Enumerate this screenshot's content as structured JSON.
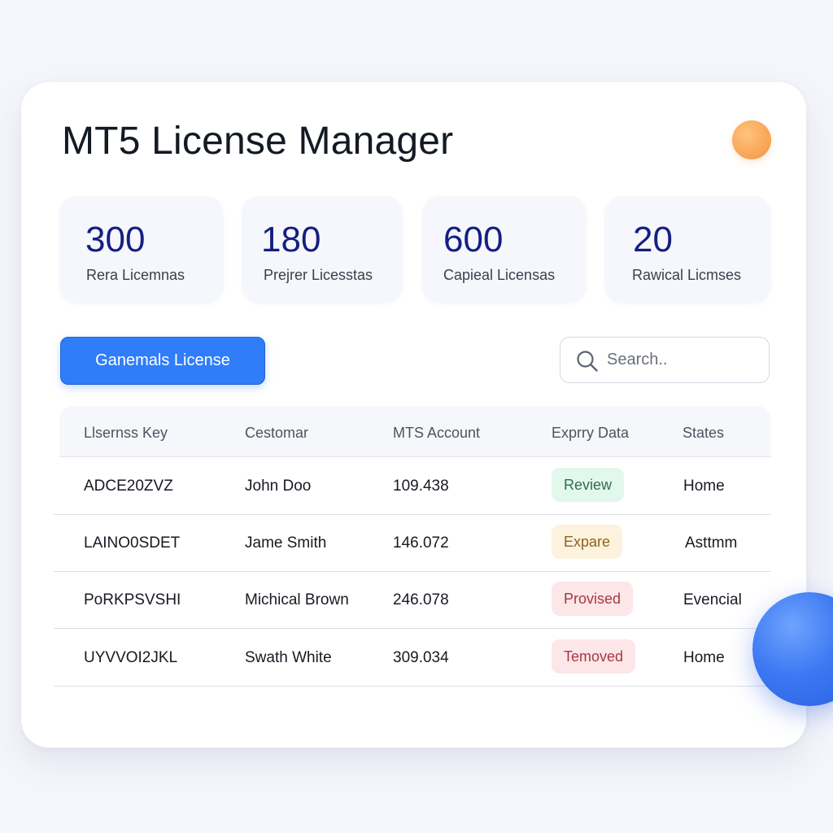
{
  "header": {
    "title": "MT5 License Manager"
  },
  "stats": [
    {
      "value": "300",
      "label": "Rera Licemnas"
    },
    {
      "value": "180",
      "label": "Prejrer Licesstas"
    },
    {
      "value": "600",
      "label": "Capieal Licensas"
    },
    {
      "value": "20",
      "label": "Rawical Licmses"
    }
  ],
  "actions": {
    "primary_label": "Ganemals License"
  },
  "search": {
    "placeholder": "Search.."
  },
  "table": {
    "columns": [
      "Llsernss Key",
      "Cestomar",
      "MTS Account",
      "Exprry Data",
      "States"
    ],
    "rows": [
      {
        "key": "ADCE20ZVZ",
        "customer": "John Doo",
        "account": "109.438",
        "expiry": "Review",
        "status": "Home"
      },
      {
        "key": "LAINO0SDET",
        "customer": "Jame Smith",
        "account": "146.072",
        "expiry": "Expare",
        "status": "Asttmm"
      },
      {
        "key": "PoRKPSVSHI",
        "customer": "Michical Brown",
        "account": "246.078",
        "expiry": "Provised",
        "status": "Evencial"
      },
      {
        "key": "UYVVOI2JKL",
        "customer": "Swath White",
        "account": "309.034",
        "expiry": "Temoved",
        "status": "Home"
      }
    ]
  },
  "colors": {
    "accent": "#2f7df8",
    "badge_review_bg": "#e3f8ec",
    "badge_review_text": "#2f6f4c",
    "badge_expare_bg": "#fdf2dd",
    "badge_expare_text": "#8a6421",
    "badge_provised_bg": "#fde6e7",
    "badge_provised_text": "#a33a43",
    "badge_removed_bg": "#fde6e7",
    "badge_removed_text": "#a33a43"
  }
}
